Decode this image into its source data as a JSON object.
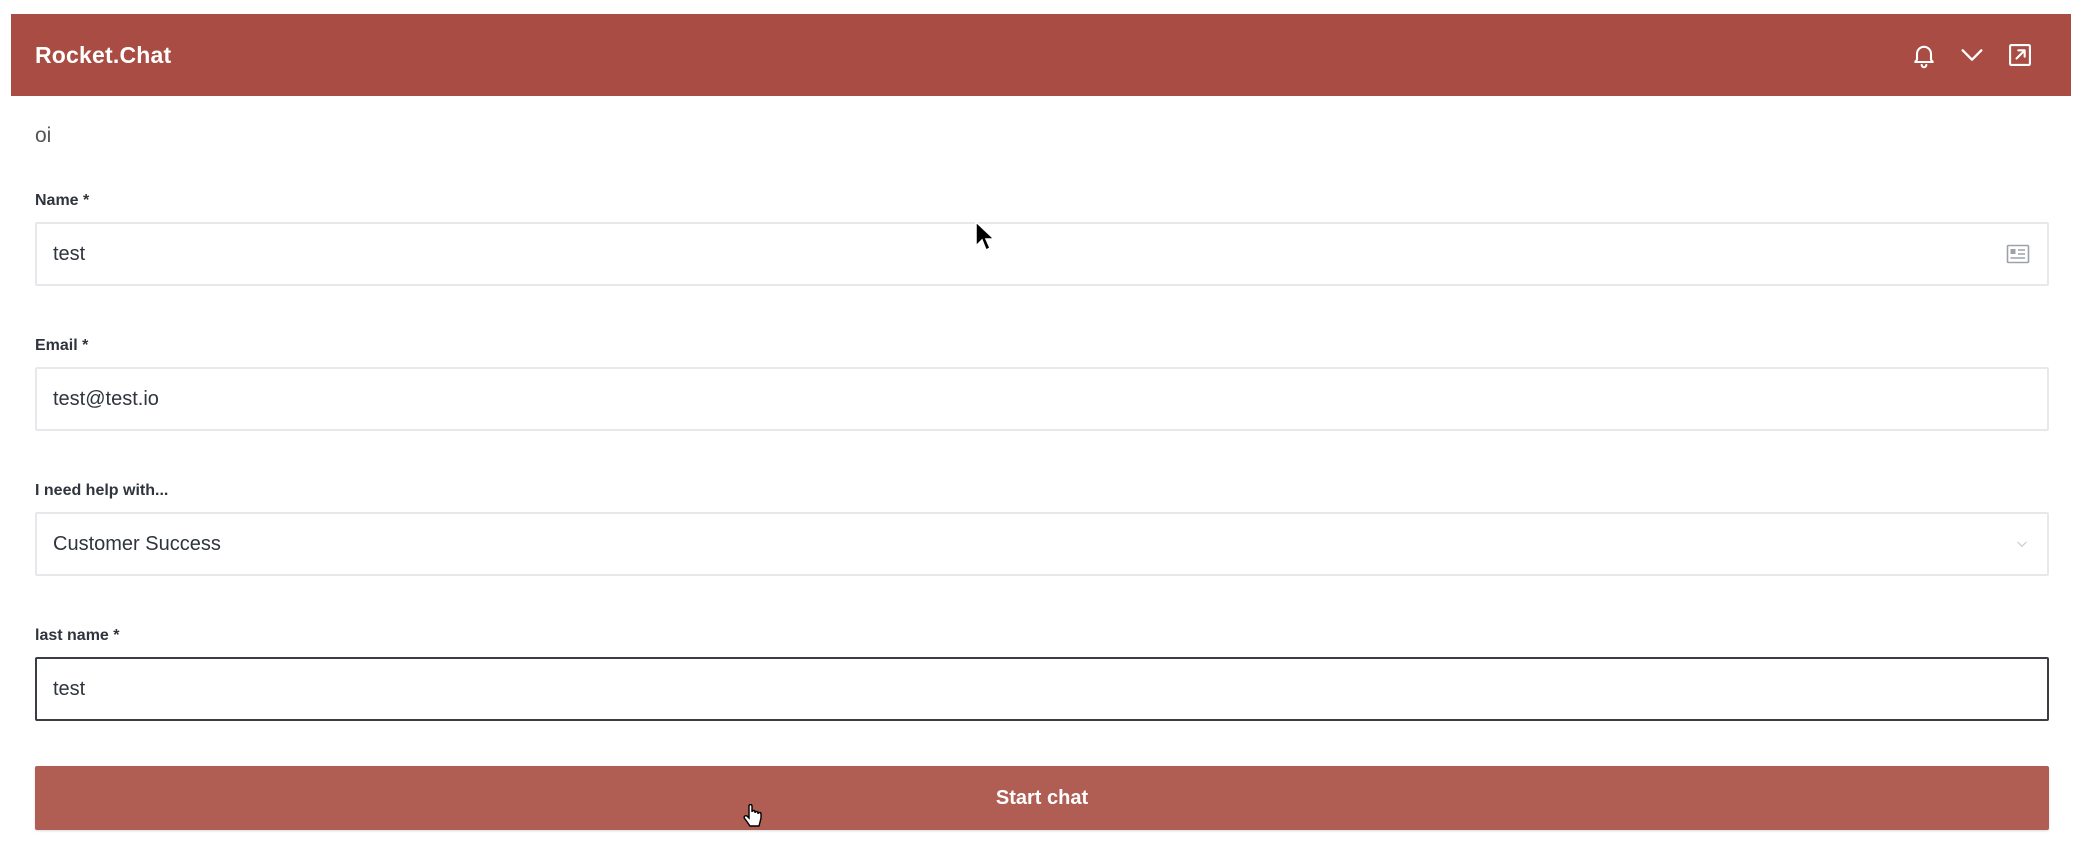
{
  "header": {
    "title": "Rocket.Chat",
    "actions": [
      {
        "icon": "bell-icon"
      },
      {
        "icon": "chevron-down-icon"
      },
      {
        "icon": "pop-out-icon"
      }
    ],
    "color": "#a94c43"
  },
  "form": {
    "intro": "oi",
    "fields": {
      "name": {
        "label": "Name *",
        "value": "test",
        "icon": "contact-card-icon"
      },
      "email": {
        "label": "Email *",
        "value": "test@test.io"
      },
      "department": {
        "label": "I need help with...",
        "value": "Customer Success"
      },
      "last_name": {
        "label": "last name *",
        "value": "test"
      }
    },
    "submit_label": "Start chat",
    "submit_color": "#b05e53"
  }
}
